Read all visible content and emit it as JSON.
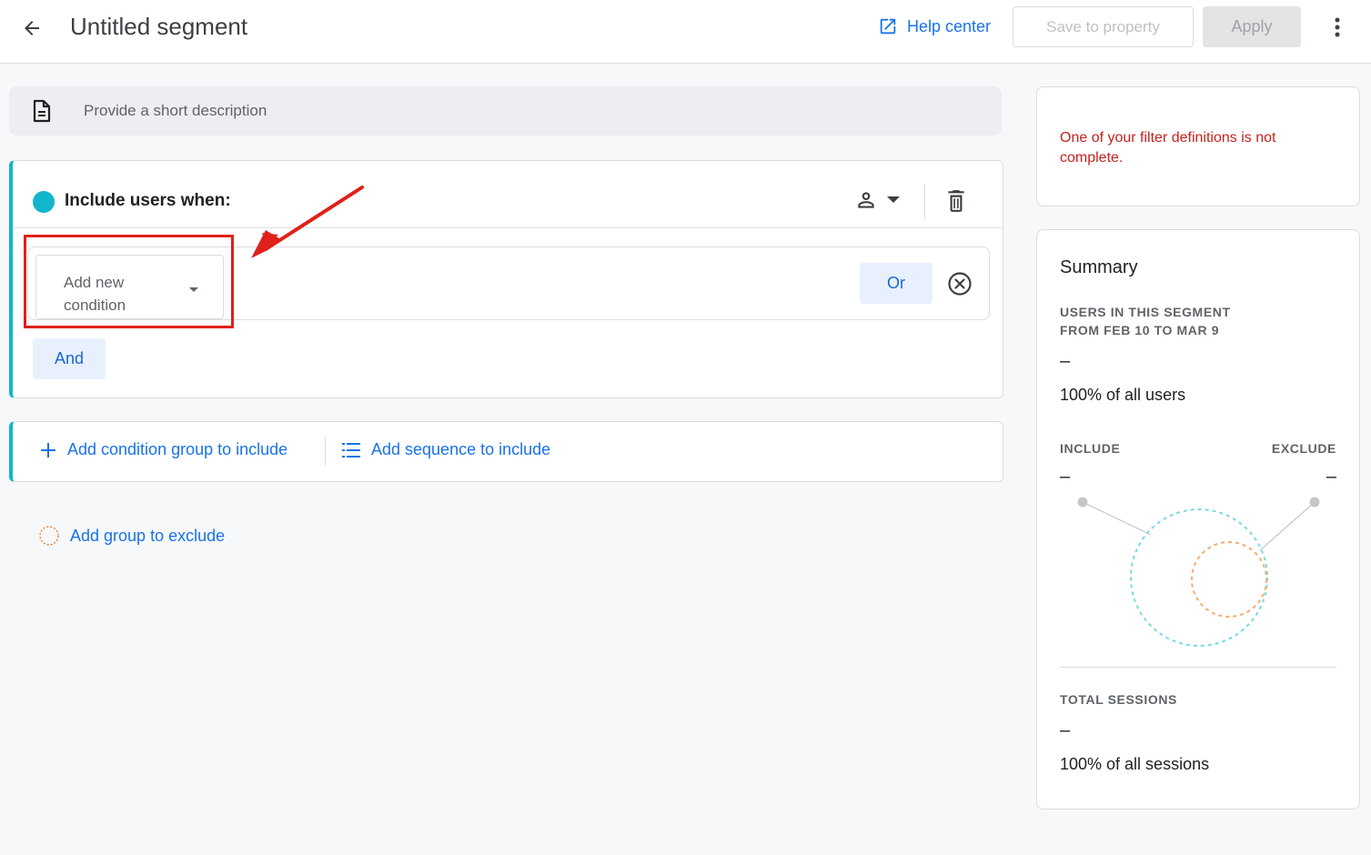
{
  "header": {
    "title": "Untitled segment",
    "help_label": "Help center",
    "save_label": "Save to property",
    "apply_label": "Apply"
  },
  "description": {
    "placeholder": "Provide a short description"
  },
  "include_group": {
    "title": "Include users when:",
    "condition_placeholder": "Add new condition",
    "or_label": "Or",
    "and_label": "And"
  },
  "add_actions": {
    "add_condition_group": "Add condition group to include",
    "add_sequence": "Add sequence to include",
    "add_exclude": "Add group to exclude"
  },
  "error": {
    "message": "One of your filter definitions is not complete."
  },
  "summary": {
    "title": "Summary",
    "users_label": "USERS IN THIS SEGMENT FROM FEB 10 TO MAR 9",
    "users_value": "–",
    "users_pct": "100% of all users",
    "include_label": "INCLUDE",
    "include_value": "–",
    "exclude_label": "EXCLUDE",
    "exclude_value": "–",
    "sessions_label": "TOTAL SESSIONS",
    "sessions_value": "–",
    "sessions_pct": "100% of all sessions"
  },
  "colors": {
    "accent": "#1a73e8",
    "include": "#12b5cb",
    "exclude": "#f4a261",
    "error": "#c5221f",
    "annotation": "#e0201a"
  },
  "icons": {
    "back": "arrow-left-icon",
    "help": "open-in-new-icon",
    "more": "more-vert-icon",
    "description": "document-icon",
    "scope": "person-icon",
    "delete": "trash-icon",
    "remove": "close-circle-icon",
    "add": "plus-icon",
    "sequence": "list-icon"
  }
}
